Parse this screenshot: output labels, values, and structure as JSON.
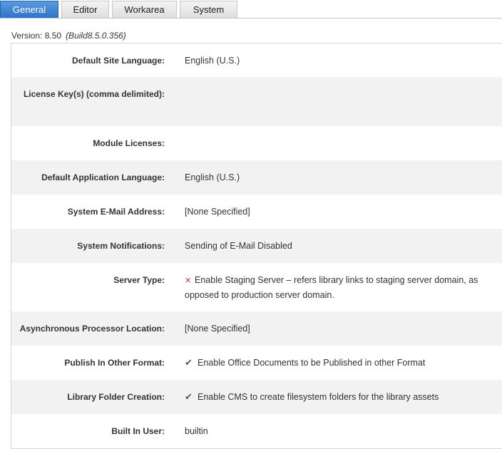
{
  "tabs": [
    {
      "label": "General",
      "active": true
    },
    {
      "label": "Editor",
      "active": false
    },
    {
      "label": "Workarea",
      "active": false
    },
    {
      "label": "System",
      "active": false
    }
  ],
  "version": {
    "text": "Version: 8.50",
    "build": "(Build8.5.0.356)"
  },
  "settings": {
    "default_site_language": {
      "label": "Default Site Language:",
      "value": "English (U.S.)"
    },
    "license_keys": {
      "label": "License Key(s) (comma delimited):",
      "value": ""
    },
    "module_licenses": {
      "label": "Module Licenses:",
      "value": ""
    },
    "default_application_language": {
      "label": "Default Application Language:",
      "value": "English (U.S.)"
    },
    "system_email": {
      "label": "System E-Mail Address:",
      "value": "[None Specified]"
    },
    "system_notifications": {
      "label": "System Notifications:",
      "value": "Sending of E-Mail Disabled"
    },
    "server_type": {
      "label": "Server Type:",
      "icon": "x-icon",
      "value": "Enable Staging Server – refers library links to staging server domain, as opposed to production server domain."
    },
    "async_processor_location": {
      "label": "Asynchronous Processor Location:",
      "value": "[None Specified]"
    },
    "publish_other_format": {
      "label": "Publish In Other Format:",
      "icon": "checkmark-icon",
      "value": "Enable Office Documents to be Published in other Format"
    },
    "library_folder_creation": {
      "label": "Library Folder Creation:",
      "icon": "checkmark-icon",
      "value": "Enable CMS to create filesystem folders for the library assets"
    },
    "built_in_user": {
      "label": "Built In User:",
      "value": "builtin"
    }
  },
  "colors": {
    "active_tab": "#3a7fd0",
    "row_shade": "#f2f2f2",
    "x_icon": "#d23c3c"
  }
}
